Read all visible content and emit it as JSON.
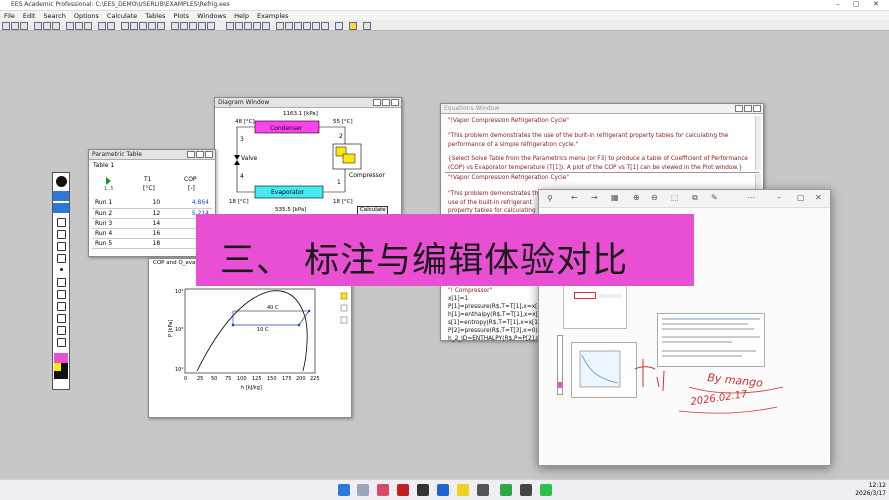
{
  "app": {
    "title": "EES Academic Professional: C:\\EES_DEMO\\USERLIB\\EXAMPLES\\Refrig.ees",
    "window_controls": [
      "–",
      "▢",
      "✕"
    ]
  },
  "menu": [
    "File",
    "Edit",
    "Search",
    "Options",
    "Calculate",
    "Tables",
    "Plots",
    "Windows",
    "Help",
    "Examples"
  ],
  "diagram_window": {
    "title": "Diagram Window",
    "pressure_high": "1163.1 [kPa]",
    "pressure_low": "535.5 [kPa]",
    "t_left_top": "48 [°C]",
    "t_right_top": "55 [°C]",
    "t_left_bottom": "18 [°C]",
    "t_right_bottom": "18 [°C]",
    "condenser": "Condenser",
    "evaporator": "Evaporator",
    "valve": "Valve",
    "compressor": "Compressor",
    "n1": "1",
    "n2": "2",
    "n3": "3",
    "n4": "4",
    "calculate": "Calculate"
  },
  "parametric": {
    "title": "Parametric Table",
    "tab": "Table 1",
    "col1_head": "T1",
    "col1_unit": "[°C]",
    "col2_head": "COP",
    "col2_unit": "[-]",
    "row_index": "1..5",
    "rows": [
      {
        "label": "Run 1",
        "t": "10",
        "cop": "4.864"
      },
      {
        "label": "Run 2",
        "t": "12",
        "cop": "5.214"
      },
      {
        "label": "Run 3",
        "t": "14",
        "cop": ""
      },
      {
        "label": "Run 4",
        "t": "16",
        "cop": ""
      },
      {
        "label": "Run 5",
        "t": "18",
        "cop": ""
      }
    ]
  },
  "plot_window": {
    "tab": "COP and Q_evap",
    "ylabel": "P [kPa]",
    "xlabel": "h [kJ/kg]",
    "iso1": "40 C",
    "iso2": "10 C",
    "xticks": [
      "0",
      "25",
      "50",
      "75",
      "100",
      "125",
      "150",
      "175",
      "200",
      "225"
    ],
    "yticks": [
      "10³",
      "10²",
      "10¹"
    ]
  },
  "equations": {
    "title": "Equations Window",
    "p1": "\"!Vapor Compression Refrigeration Cycle\"",
    "p2": "\"This problem demonstrates the use of the built-in refrigerant property tables for calculating the performance of a simple refrigeration cycle.\"",
    "p3": "{Select Solve Table from the Parametrics menu (or F3) to produce a table of Coefficient of Performance (COP) vs Evaporator temperature (T[1]).  A plot of the COP vs T[1] can be viewed in the Plot window.}",
    "p4": "\"!Vapor Compression Refrigeration Cycle\"",
    "p5": "\"This problem demonstrates the use of the built-in refrigerant property tables for calculating the performance of a simple refrigeration cycle.\"",
    "lines": [
      "\"! Compressor\"",
      "x[1]=1",
      "P[1]=pressure(R$,T=T[1],x=x[1])",
      "h[1]=enthalpy(R$,T=T[1],x=x[1])",
      "s[1]=entropy(R$,T=T[1],x=x[1])",
      "P[2]=pressure(R$,T=T[3],x=0)",
      "h_2_ID=ENTHALPY(R$,P=P[2],s=s[1])"
    ]
  },
  "banner": "三、 标注与编辑体验对比",
  "photo": {
    "caption": "",
    "note1": "By mango",
    "note2": "2026.02.17"
  },
  "clock": {
    "time": "12:12",
    "date": "2026/3/17"
  },
  "colors": {
    "accent": "#e84fd3",
    "condenser": "#ff44ee",
    "evaporator": "#44eaf2",
    "ink": "#d43030"
  }
}
